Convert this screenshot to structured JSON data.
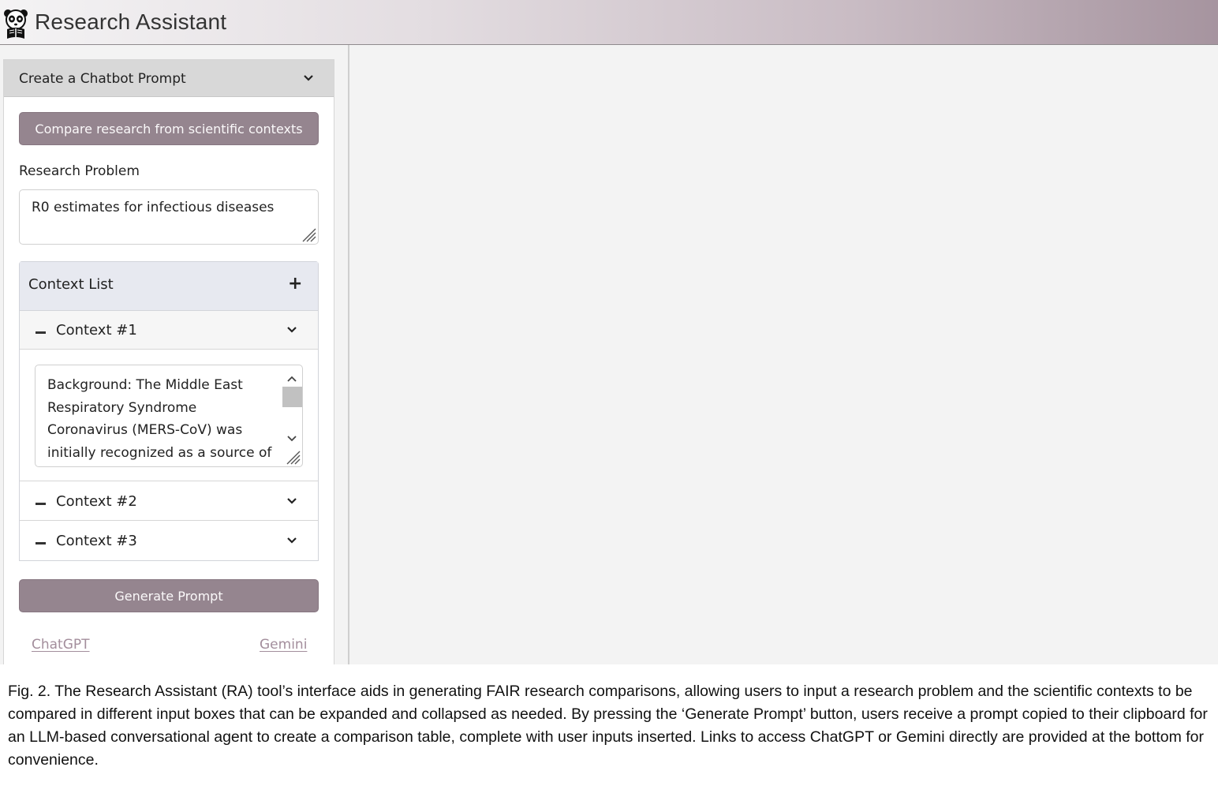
{
  "header": {
    "title": "Research Assistant",
    "logo_icon": "panda-reader-icon"
  },
  "sidebar": {
    "panel_title": "Create a Chatbot Prompt",
    "compare_button": "Compare research from scientific contexts",
    "research_problem": {
      "label": "Research Problem",
      "value": "R0 estimates for infectious diseases"
    },
    "context_list": {
      "title": "Context List",
      "add_icon": "+",
      "items": [
        {
          "label": "Context #1",
          "expanded": true,
          "text": "Background: The Middle East Respiratory Syndrome Coronavirus (MERS-CoV) was initially recognized as a source of"
        },
        {
          "label": "Context #2",
          "expanded": false
        },
        {
          "label": "Context #3",
          "expanded": false
        }
      ]
    },
    "generate_button": "Generate Prompt",
    "links": {
      "chatgpt": "ChatGPT",
      "gemini": "Gemini"
    }
  },
  "colors": {
    "button_bg": "#95858f",
    "header_gradient_end": "#a6949f",
    "link": "#a38e9c",
    "context_list_bg": "#e7e9f0"
  },
  "caption": "Fig. 2. The Research Assistant (RA) tool’s interface aids in generating FAIR research comparisons, allowing users to input a research problem and the scientific contexts to be compared in different input boxes that can be expanded and collapsed as needed. By pressing the ‘Generate Prompt’ button, users receive a prompt copied to their clipboard for an LLM-based conversational agent to create a comparison table, complete with user inputs inserted. Links to access ChatGPT or Gemini directly are provided at the bottom for convenience."
}
